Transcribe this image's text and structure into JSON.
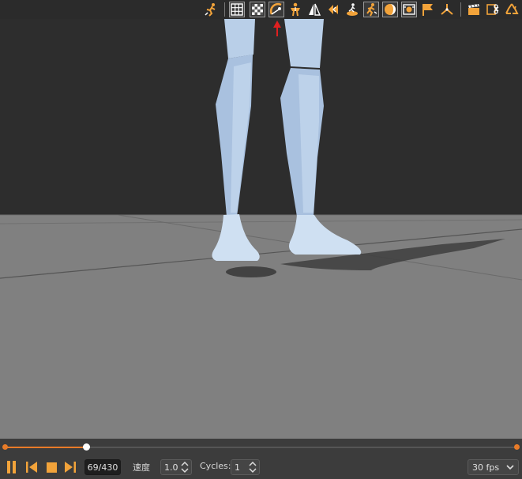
{
  "toolbar": {
    "icons": [
      "character-pose-icon",
      "grid-icon",
      "checkerboard-floor-icon",
      "light-arc-icon",
      "skeleton-icon",
      "mirror-symmetry-icon",
      "rewind-icon",
      "root-motion-icon",
      "walk-in-place-icon",
      "shading-icon",
      "camera-frame-icon",
      "flag-icon",
      "axes-icon",
      "clapperboard-icon",
      "export-scissors-icon",
      "recycle-icon"
    ],
    "accent_color": "#f2a33a"
  },
  "viewport": {
    "background_color": "#2d2d2d",
    "floor_color": "#808080",
    "character_color": "#b9cfe8"
  },
  "timeline": {
    "progress": 0.16,
    "accent_color": "#e87b28"
  },
  "controls": {
    "frame_counter": "69/430",
    "speed_label": "速度",
    "speed_value": "1.0",
    "cycles_label": "Cycles:",
    "cycles_value": "1",
    "fps_value": "30 fps"
  }
}
